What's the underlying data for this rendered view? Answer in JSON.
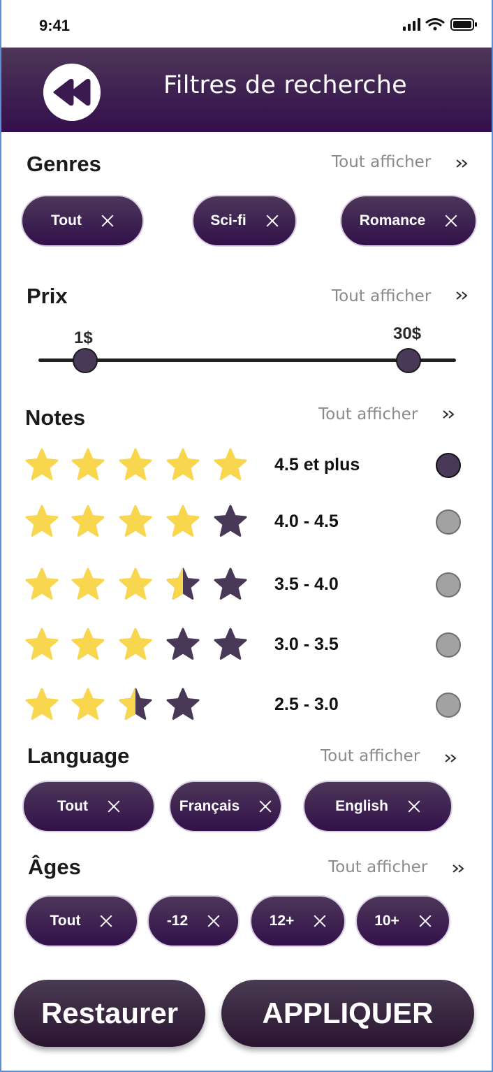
{
  "status": {
    "time": "9:41"
  },
  "header": {
    "title": "Filtres de recherche",
    "back_icon": "rewind-icon"
  },
  "show_all_label": "Tout afficher",
  "genres": {
    "title": "Genres",
    "chips": [
      {
        "label": "Tout"
      },
      {
        "label": "Sci-fi"
      },
      {
        "label": "Romance"
      }
    ]
  },
  "price": {
    "title": "Prix",
    "min": "1$",
    "max": "30$"
  },
  "notes": {
    "title": "Notes",
    "rows": [
      {
        "label": "4.5 et plus",
        "stars_filled": 5,
        "selected": true
      },
      {
        "label": "4.0 - 4.5",
        "stars_filled": 4,
        "selected": false
      },
      {
        "label": "3.5 - 4.0",
        "stars_filled": 3.5,
        "selected": false
      },
      {
        "label": "3.0 - 3.5",
        "stars_filled": 3,
        "selected": false
      },
      {
        "label": "2.5 - 3.0",
        "stars_filled": 2.5,
        "selected": false
      }
    ]
  },
  "language": {
    "title": "Language",
    "chips": [
      {
        "label": "Tout"
      },
      {
        "label": "Français"
      },
      {
        "label": "English"
      }
    ]
  },
  "ages": {
    "title": "Âges",
    "chips": [
      {
        "label": "Tout"
      },
      {
        "label": "-12"
      },
      {
        "label": "12+"
      },
      {
        "label": "10+"
      }
    ]
  },
  "actions": {
    "reset": "Restaurer",
    "apply": "APPLIQUER"
  },
  "colors": {
    "accent": "#36104e",
    "star_filled": "#f8d64e",
    "star_empty": "#4a3858",
    "radio_selected": "#4a3858",
    "radio_unselected": "#a2a2a2"
  }
}
